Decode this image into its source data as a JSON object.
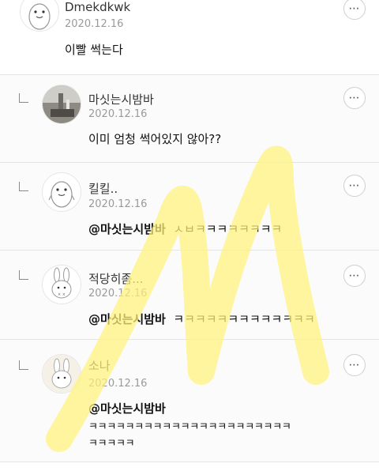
{
  "comments": [
    {
      "author": "Dmekdkwk",
      "date": "2020.12.16",
      "text": "이빨 썩는다",
      "avatar": "penguin-avatar"
    },
    {
      "author": "마싯는시밤바",
      "date": "2020.12.16",
      "text": "이미 엄청 썩어있지 않아??",
      "avatar": "room-photo-avatar"
    },
    {
      "author": "킬킬..",
      "date": "2020.12.16",
      "mention": "@마싯는시밤바",
      "text": "ㅅㅂㅋㅋㅋㅋㅋㅋㅋㅋ",
      "avatar": "penguin-avatar"
    },
    {
      "author": "적당히좀...",
      "date": "2020.12.16",
      "mention": "@마싯는시밤바",
      "text": "ㅋㅋㅋㅋㅋㅋㅋㅋㅋㅋㅋㅋㅋ",
      "avatar": "bunny-avatar"
    },
    {
      "author": "소나",
      "date": "2020.12.16",
      "mention": "@마싯는시밤바",
      "text": "ㅋㅋㅋㅋㅋㅋㅋㅋㅋㅋㅋㅋㅋㅋㅋㅋㅋㅋㅋㅋㅋㅋ",
      "text_line2": "ㅋㅋㅋㅋㅋ",
      "avatar": "bunny-avatar"
    }
  ],
  "more_icon": "⋯",
  "colors": {
    "highlight": "#fff27a",
    "separator": "#e4e4e4",
    "date": "#9a9a9a"
  }
}
